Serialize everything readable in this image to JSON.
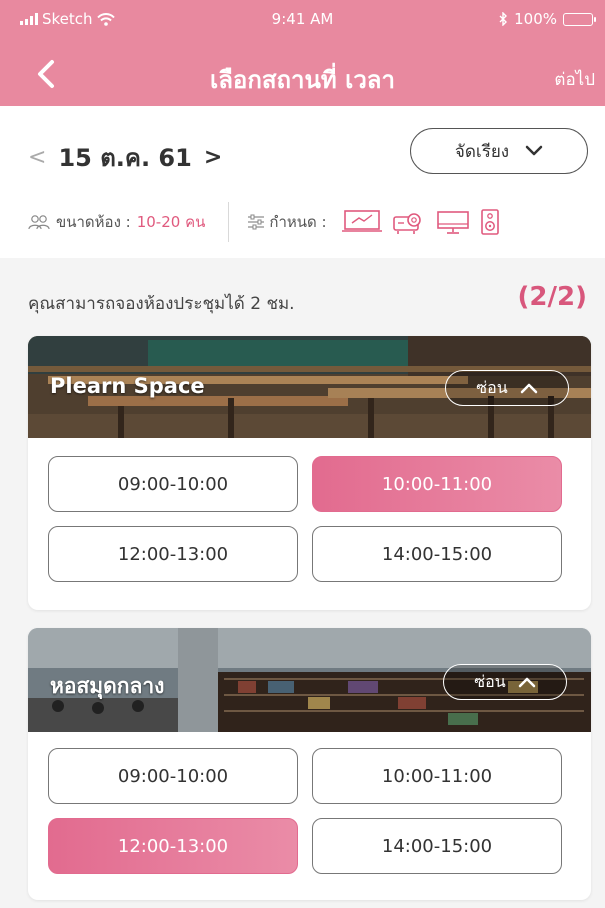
{
  "status_bar": {
    "carrier": "Sketch",
    "time": "9:41 AM",
    "battery": "100%"
  },
  "nav": {
    "title": "เลือกสถานที่ เวลา",
    "next_label": "ต่อไป"
  },
  "filter": {
    "date": "15 ต.ค. 61",
    "sort_label": "จัดเรียง",
    "room_size_label": "ขนาดห้อง :",
    "room_size_value": "10-20 คน",
    "equipment_label": "กำหนด :",
    "equipment_icons": [
      "chart-screen-icon",
      "projector-icon",
      "monitor-icon",
      "speaker-icon"
    ]
  },
  "booking": {
    "hint": "คุณสามารถจองห้องประชุมได้ 2 ชม.",
    "quota": "(2/2)"
  },
  "venues": [
    {
      "name": "Plearn Space",
      "hide_label": "ซ่อน",
      "slots": [
        {
          "time": "09:00-10:00",
          "selected": false
        },
        {
          "time": "10:00-11:00",
          "selected": true
        },
        {
          "time": "12:00-13:00",
          "selected": false
        },
        {
          "time": "14:00-15:00",
          "selected": false
        }
      ]
    },
    {
      "name": "หอสมุดกลาง",
      "hide_label": "ซ่อน",
      "slots": [
        {
          "time": "09:00-10:00",
          "selected": false
        },
        {
          "time": "10:00-11:00",
          "selected": false
        },
        {
          "time": "12:00-13:00",
          "selected": true
        },
        {
          "time": "14:00-15:00",
          "selected": false
        }
      ]
    }
  ],
  "colors": {
    "header": "#e8899f",
    "accent": "#d8577c",
    "selected_slot": "#e26b8f"
  }
}
